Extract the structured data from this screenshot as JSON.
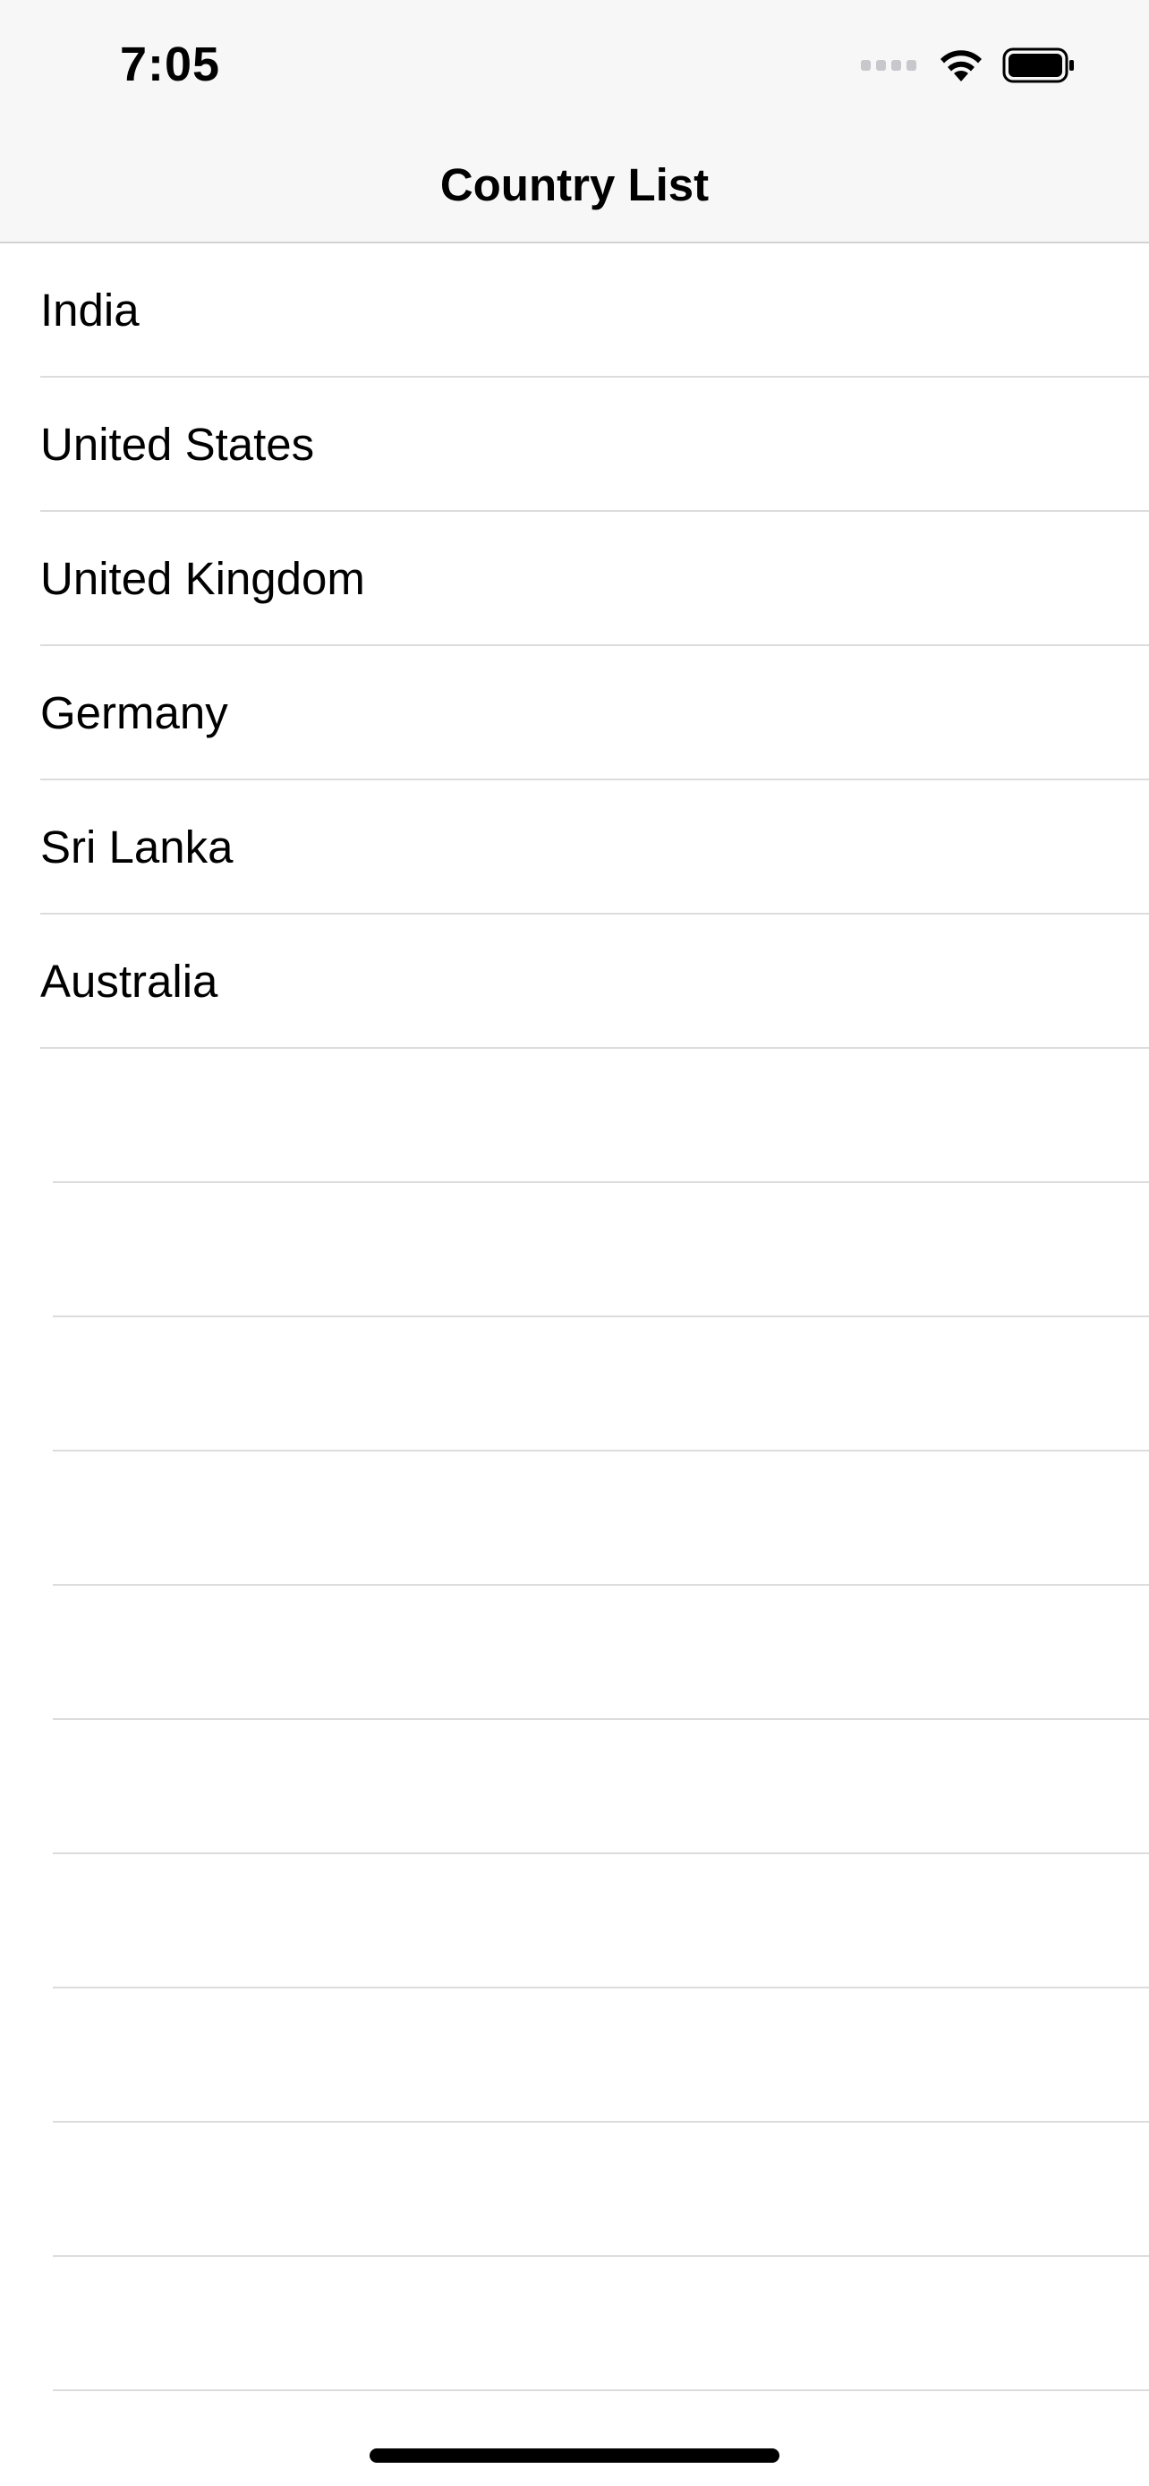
{
  "status_bar": {
    "time": "7:05",
    "icons": [
      "cellular-signal-icon",
      "wifi-icon",
      "battery-icon"
    ]
  },
  "nav": {
    "title": "Country List"
  },
  "countries": [
    {
      "name": "India"
    },
    {
      "name": "United States"
    },
    {
      "name": "United Kingdom"
    },
    {
      "name": "Germany"
    },
    {
      "name": "Sri Lanka"
    },
    {
      "name": "Australia"
    }
  ],
  "colors": {
    "header_background": "#f7f7f7",
    "separator": "#dcdcde",
    "text": "#000000"
  }
}
